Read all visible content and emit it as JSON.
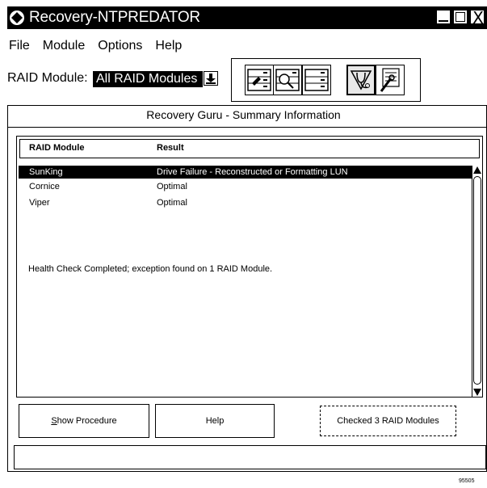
{
  "window": {
    "title": "Recovery-NTPREDATOR",
    "minimize_label": "_",
    "maximize_label": "☐",
    "close_label": "X"
  },
  "menu": [
    {
      "label": "File"
    },
    {
      "label": "Module"
    },
    {
      "label": "Options"
    },
    {
      "label": "Help"
    }
  ],
  "raid_selector": {
    "label": "RAID Module:",
    "value": "All RAID Modules"
  },
  "toolbar": {
    "icons": [
      "configuration-icon",
      "status-icon",
      "recovery-icon",
      "recovery-guru-icon",
      "maintenance-icon"
    ],
    "pressed": "recovery-guru-icon"
  },
  "summary": {
    "title": "Recovery Guru - Summary Information",
    "columns": [
      "RAID Module",
      "Result"
    ],
    "rows": [
      {
        "module": "SunKing",
        "result": "Drive Failure - Reconstructed or Formatting LUN",
        "selected": true
      },
      {
        "module": "Cornice",
        "result": "Optimal",
        "selected": false
      },
      {
        "module": "Viper",
        "result": "Optimal",
        "selected": false
      }
    ],
    "message": "Health Check Completed; exception found on 1 RAID Module."
  },
  "buttons": {
    "show_procedure_first": "S",
    "show_procedure_rest": "how Procedure",
    "help": "Help",
    "checked": "Checked 3 RAID Modules"
  },
  "status": "",
  "figure_id": "95505"
}
